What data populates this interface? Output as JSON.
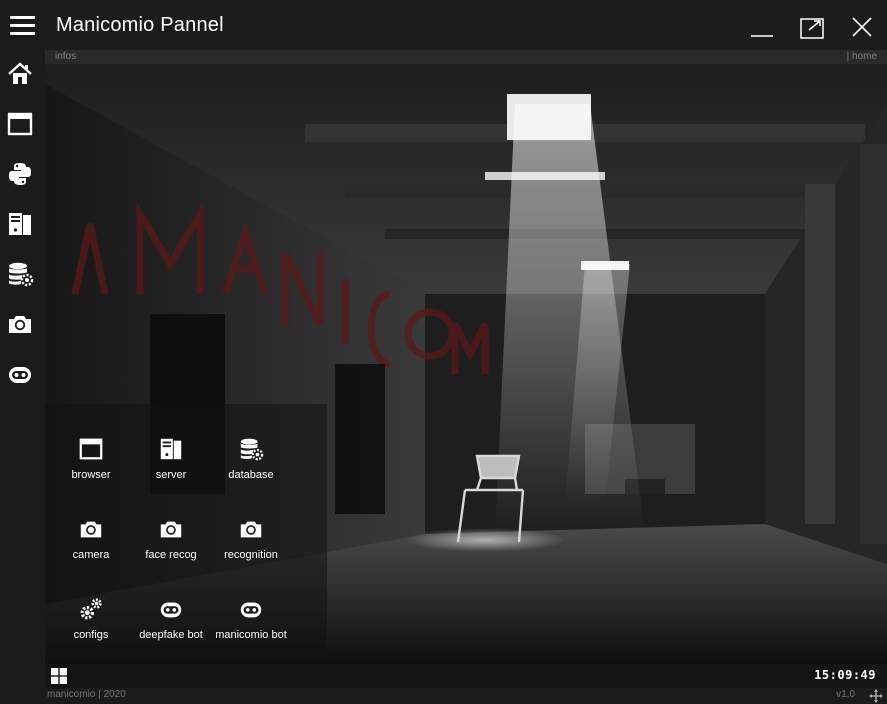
{
  "window": {
    "title": "Manicomio Pannel"
  },
  "sidebar": {
    "items": [
      {
        "icon": "home-icon"
      },
      {
        "icon": "browser-window-icon"
      },
      {
        "icon": "python-icon"
      },
      {
        "icon": "server-icon"
      },
      {
        "icon": "database-gear-icon"
      },
      {
        "icon": "camera-icon"
      },
      {
        "icon": "robot-icon"
      }
    ]
  },
  "infobar": {
    "left": "infos",
    "right": "| home"
  },
  "tiles": [
    {
      "label": "browser",
      "icon": "browser-window-icon"
    },
    {
      "label": "server",
      "icon": "server-icon"
    },
    {
      "label": "database",
      "icon": "database-gear-icon"
    },
    {
      "label": "camera",
      "icon": "camera-icon"
    },
    {
      "label": "face recog",
      "icon": "camera-icon"
    },
    {
      "label": "recognition",
      "icon": "camera-icon"
    },
    {
      "label": "configs",
      "icon": "gears-icon"
    },
    {
      "label": "deepfake bot",
      "icon": "robot-icon"
    },
    {
      "label": "manicomio bot",
      "icon": "robot-icon"
    }
  ],
  "taskbar": {
    "clock": "15:09:49"
  },
  "footer": {
    "left": "manicomio | 2020",
    "version": "v1.0"
  },
  "colors": {
    "titlebar": "#1c1c1c",
    "sidebar": "#1b1b1b",
    "infobar": "#2a2a2a",
    "text": "#ffffff",
    "muted": "#808080"
  }
}
